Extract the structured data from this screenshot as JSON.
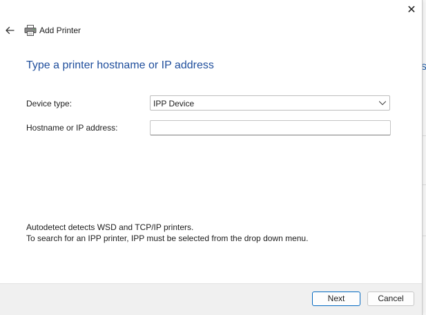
{
  "window": {
    "title": "Add Printer",
    "close_glyph": "✕"
  },
  "main": {
    "heading": "Type a printer hostname or IP address",
    "device_type": {
      "label": "Device type:",
      "selected": "IPP Device"
    },
    "hostname": {
      "label": "Hostname or IP address:",
      "value": "",
      "placeholder": ""
    },
    "hint_lines": [
      "Autodetect detects WSD and TCP/IP printers.",
      "To search for an IPP printer, IPP must be selected from the drop down menu."
    ]
  },
  "footer": {
    "next_label": "Next",
    "cancel_label": "Cancel"
  },
  "background": {
    "partial_letter": "s"
  },
  "icons": {
    "back": "back-arrow-icon",
    "printer": "printer-icon",
    "close": "close-icon",
    "chevron": "chevron-down-icon"
  },
  "colors": {
    "heading": "#1f4e9c",
    "accent": "#0067c0",
    "footer_bg": "#f0f0f0"
  }
}
